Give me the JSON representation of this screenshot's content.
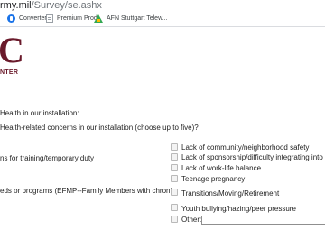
{
  "browser": {
    "url": "rmy.mil/Survey/se.ashx",
    "url_host_visible": "rmy.mil",
    "url_path": "/Survey/se.ashx",
    "bookmarks": [
      {
        "label": "Converter",
        "icon": "converter-icon"
      },
      {
        "label": "Premium Prod",
        "icon": "document-icon"
      },
      {
        "label": "AFN Stuttgart Telew...",
        "icon": "drive-icon"
      }
    ]
  },
  "logo": {
    "letter": "C",
    "subtitle": "NTER",
    "color": "#6a1a2b"
  },
  "survey": {
    "section_heading": "Health in our installation:",
    "question": "Health-related concerns in our installation (choose up to five)?",
    "left_fragments": [
      "ns for training/temporary duty",
      "eds or programs (EFMP--Family Members with chronic"
    ],
    "options": [
      {
        "label": "Lack of community/neighborhood safety",
        "checked": false
      },
      {
        "label": "Lack of sponsorship/difficulty integrating into the",
        "checked": false
      },
      {
        "label": "Lack of work-life balance",
        "checked": false
      },
      {
        "label": "Teenage pregnancy",
        "checked": false
      },
      {
        "label": "Transitions/Moving/Retirement",
        "checked": false
      },
      {
        "label": "Youth bullying/hazing/peer pressure",
        "checked": false
      },
      {
        "label": "Other:",
        "checked": false,
        "has_text_field": true,
        "text_value": ""
      }
    ]
  }
}
